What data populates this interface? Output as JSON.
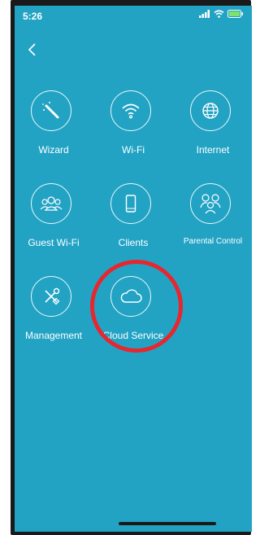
{
  "status_bar": {
    "time": "5:26"
  },
  "tiles": [
    {
      "label": "Wizard",
      "icon": "wand-icon"
    },
    {
      "label": "Wi-Fi",
      "icon": "wifi-icon"
    },
    {
      "label": "Internet",
      "icon": "globe-icon"
    },
    {
      "label": "Guest Wi-Fi",
      "icon": "guests-icon"
    },
    {
      "label": "Clients",
      "icon": "phone-icon"
    },
    {
      "label": "Parental Control",
      "icon": "family-icon"
    },
    {
      "label": "Management",
      "icon": "tools-icon"
    },
    {
      "label": "Cloud Service",
      "icon": "cloud-icon"
    }
  ],
  "colors": {
    "background": "#22a3c4",
    "highlight": "#e8262d"
  }
}
